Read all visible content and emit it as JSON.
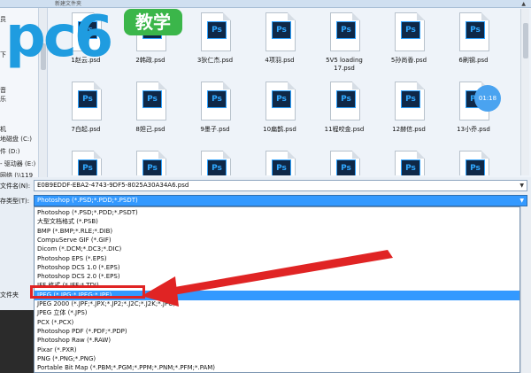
{
  "window": {
    "title": "新建文件夹"
  },
  "logo": {
    "text": "pc6",
    "badge": "教学"
  },
  "nav": {
    "items": [
      "员",
      "",
      "",
      "",
      "下",
      "",
      "",
      "音",
      "乐",
      "",
      "",
      "",
      "机",
      "地磁盘 (C:)",
      "件 (D:)",
      "- 驱动器 (E:)",
      "网络 (\\\\119"
    ]
  },
  "files": [
    {
      "name": "1赵云.psd"
    },
    {
      "name": "2韩政.psd"
    },
    {
      "name": "3狄仁杰.psd"
    },
    {
      "name": "4项羽.psd"
    },
    {
      "name": "5V5 loading 17.psd"
    },
    {
      "name": "5孙尚香.psd"
    },
    {
      "name": "6刷钢.psd"
    },
    {
      "name": "7白起.psd"
    },
    {
      "name": "8妲己.psd"
    },
    {
      "name": "9墨子.psd"
    },
    {
      "name": "10扁鹊.psd"
    },
    {
      "name": "11程咬金.psd"
    },
    {
      "name": "12赫信.psd"
    },
    {
      "name": "13小乔.psd"
    },
    {
      "name": ""
    },
    {
      "name": ""
    },
    {
      "name": ""
    },
    {
      "name": ""
    },
    {
      "name": ""
    },
    {
      "name": ""
    },
    {
      "name": ""
    }
  ],
  "ps_label": "Ps",
  "timer": "01:18",
  "filename": {
    "label": "文件名(N):",
    "value": "E0B9EDDF-EBA2-4743-9DF5-8025A30A34A6.psd"
  },
  "savetype": {
    "label": "存类型(T):",
    "value": "Photoshop (*.PSD;*.PDD;*.PSDT)"
  },
  "folder_label": "文件夹",
  "options": [
    "Photoshop (*.PSD;*.PDD;*.PSDT)",
    "大型文档格式 (*.PSB)",
    "BMP (*.BMP;*.RLE;*.DIB)",
    "CompuServe GIF (*.GIF)",
    "Dicom (*.DCM;*.DC3;*.DIC)",
    "Photoshop EPS (*.EPS)",
    "Photoshop DCS 1.0 (*.EPS)",
    "Photoshop DCS 2.0 (*.EPS)",
    "IFF 格式 (*.IFF;*.TDI)",
    "JPEG (*.JPG;*.JPEG;*.JPE)",
    "JPEG 2000 (*.JPF;*.JPX;*.JP2;*.J2C;*.J2K;*.JPC)",
    "JPEG 立体 (*.JPS)",
    "PCX (*.PCX)",
    "Photoshop PDF (*.PDF;*.PDP)",
    "Photoshop Raw (*.RAW)",
    "Pixar (*.PXR)",
    "PNG (*.PNG;*.PNG)",
    "Portable Bit Map (*.PBM;*.PGM;*.PPM;*.PNM;*.PFM;*.PAM)"
  ],
  "colors": {
    "highlight": "#3399ff",
    "annotation": "#e02424",
    "logo": "#1f9ce0",
    "badge": "#3bb64a"
  }
}
